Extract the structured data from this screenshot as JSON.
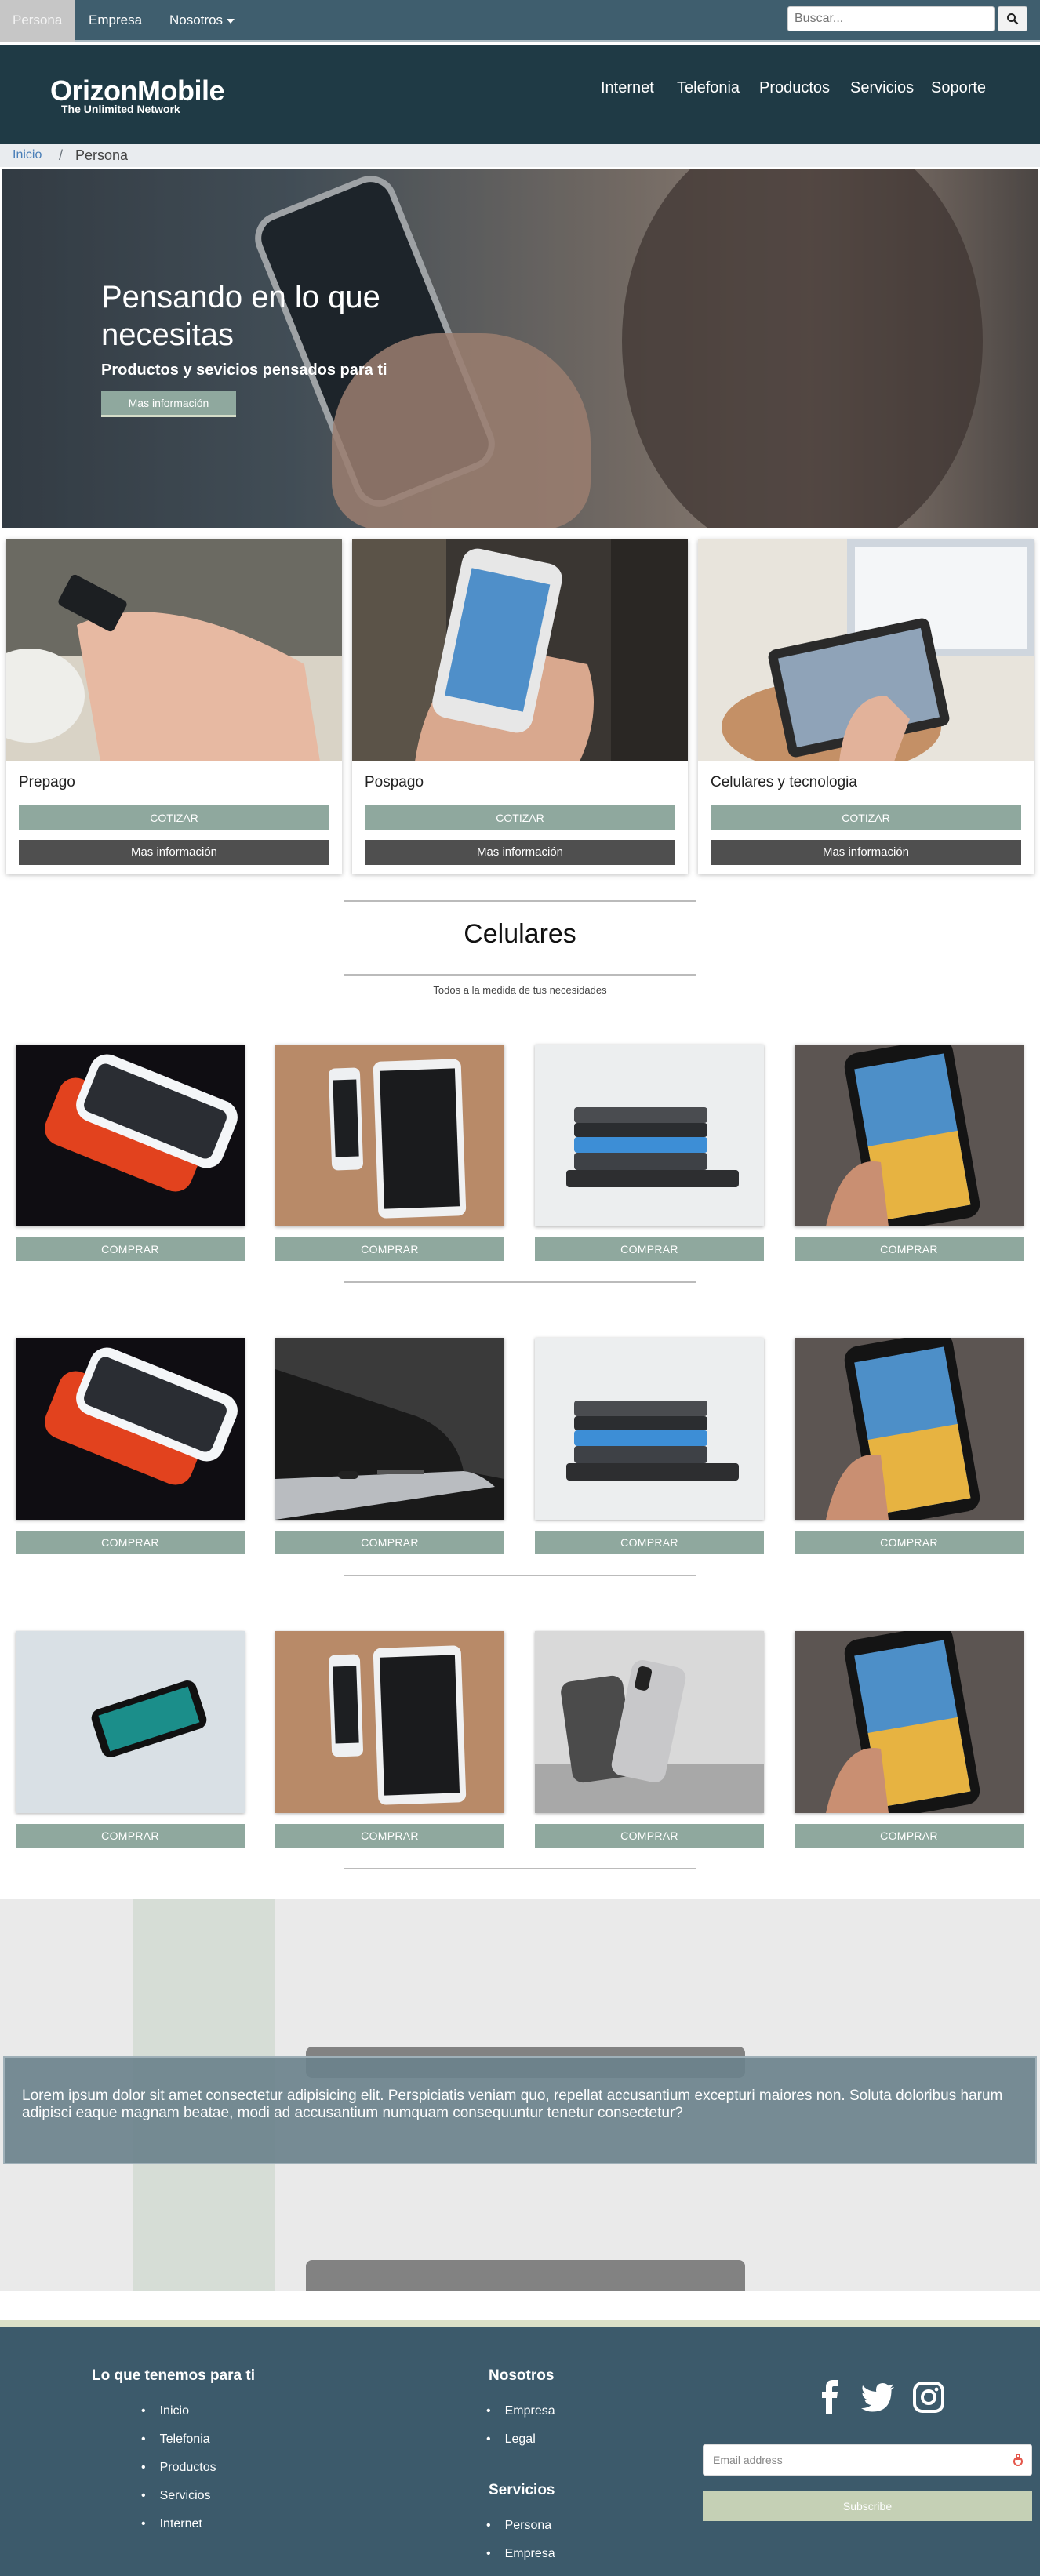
{
  "topbar": {
    "tabs": [
      {
        "label": "Persona"
      },
      {
        "label": "Empresa"
      },
      {
        "label": "Nosotros"
      }
    ],
    "search_placeholder": "Buscar..."
  },
  "header": {
    "logo": "OrizonMobile",
    "tagline": "The Unlimited Network",
    "nav": [
      "Internet",
      "Telefonia",
      "Productos",
      "Servicios",
      "Soporte"
    ]
  },
  "breadcrumb": {
    "items": [
      "Inicio",
      "Persona"
    ],
    "separator": "/"
  },
  "hero": {
    "title": "Pensando en lo que necesitas",
    "subtitle": "Productos y sevicios pensados para ti",
    "button": "Mas información"
  },
  "cards": [
    {
      "title": "Prepago",
      "quote": "COTIZAR",
      "more": "Mas información"
    },
    {
      "title": "Pospago",
      "quote": "COTIZAR",
      "more": "Mas información"
    },
    {
      "title": "Celulares y tecnologia",
      "quote": "COTIZAR",
      "more": "Mas información"
    }
  ],
  "section": {
    "title": "Celulares",
    "subtitle": "Todos a la medida de tus necesidades"
  },
  "products": {
    "buy_label": "COMPRAR",
    "rows": [
      [
        "red-white-phones",
        "phone-and-tablet",
        "stacked-phones",
        "hand-held-phone"
      ],
      [
        "red-white-phones",
        "phone-port-closeup",
        "stacked-phones",
        "hand-held-phone"
      ],
      [
        "phone-on-glass",
        "phone-and-tablet",
        "phone-on-stand",
        "hand-held-phone"
      ]
    ]
  },
  "banner": {
    "text": "Lorem ipsum dolor sit amet consectetur adipisicing elit. Perspiciatis veniam quo, repellat accusantium excepturi maiores non. Soluta doloribus harum adipisci eaque magnam beatae, modi ad accusantium numquam consequuntur tenetur consectetur?"
  },
  "footer": {
    "col1_title": "Lo que tenemos para ti",
    "col1_items": [
      "Inicio",
      "Telefonia",
      "Productos",
      "Servicios",
      "Internet"
    ],
    "col2_title": "Nosotros",
    "col2_items": [
      "Empresa",
      "Legal"
    ],
    "col3_title": "Servicios",
    "col3_items": [
      "Persona",
      "Empresa"
    ],
    "social_icons": [
      "facebook-icon",
      "twitter-icon",
      "instagram-icon"
    ],
    "email_placeholder": "Email address",
    "subscribe": "Subscribe"
  },
  "colors": {
    "topbar": "#3f5e6e",
    "header": "#1f3a45",
    "accent_button": "#8fa89e",
    "dark_button": "#4f4f4f",
    "footer": "#3c5a6b"
  }
}
